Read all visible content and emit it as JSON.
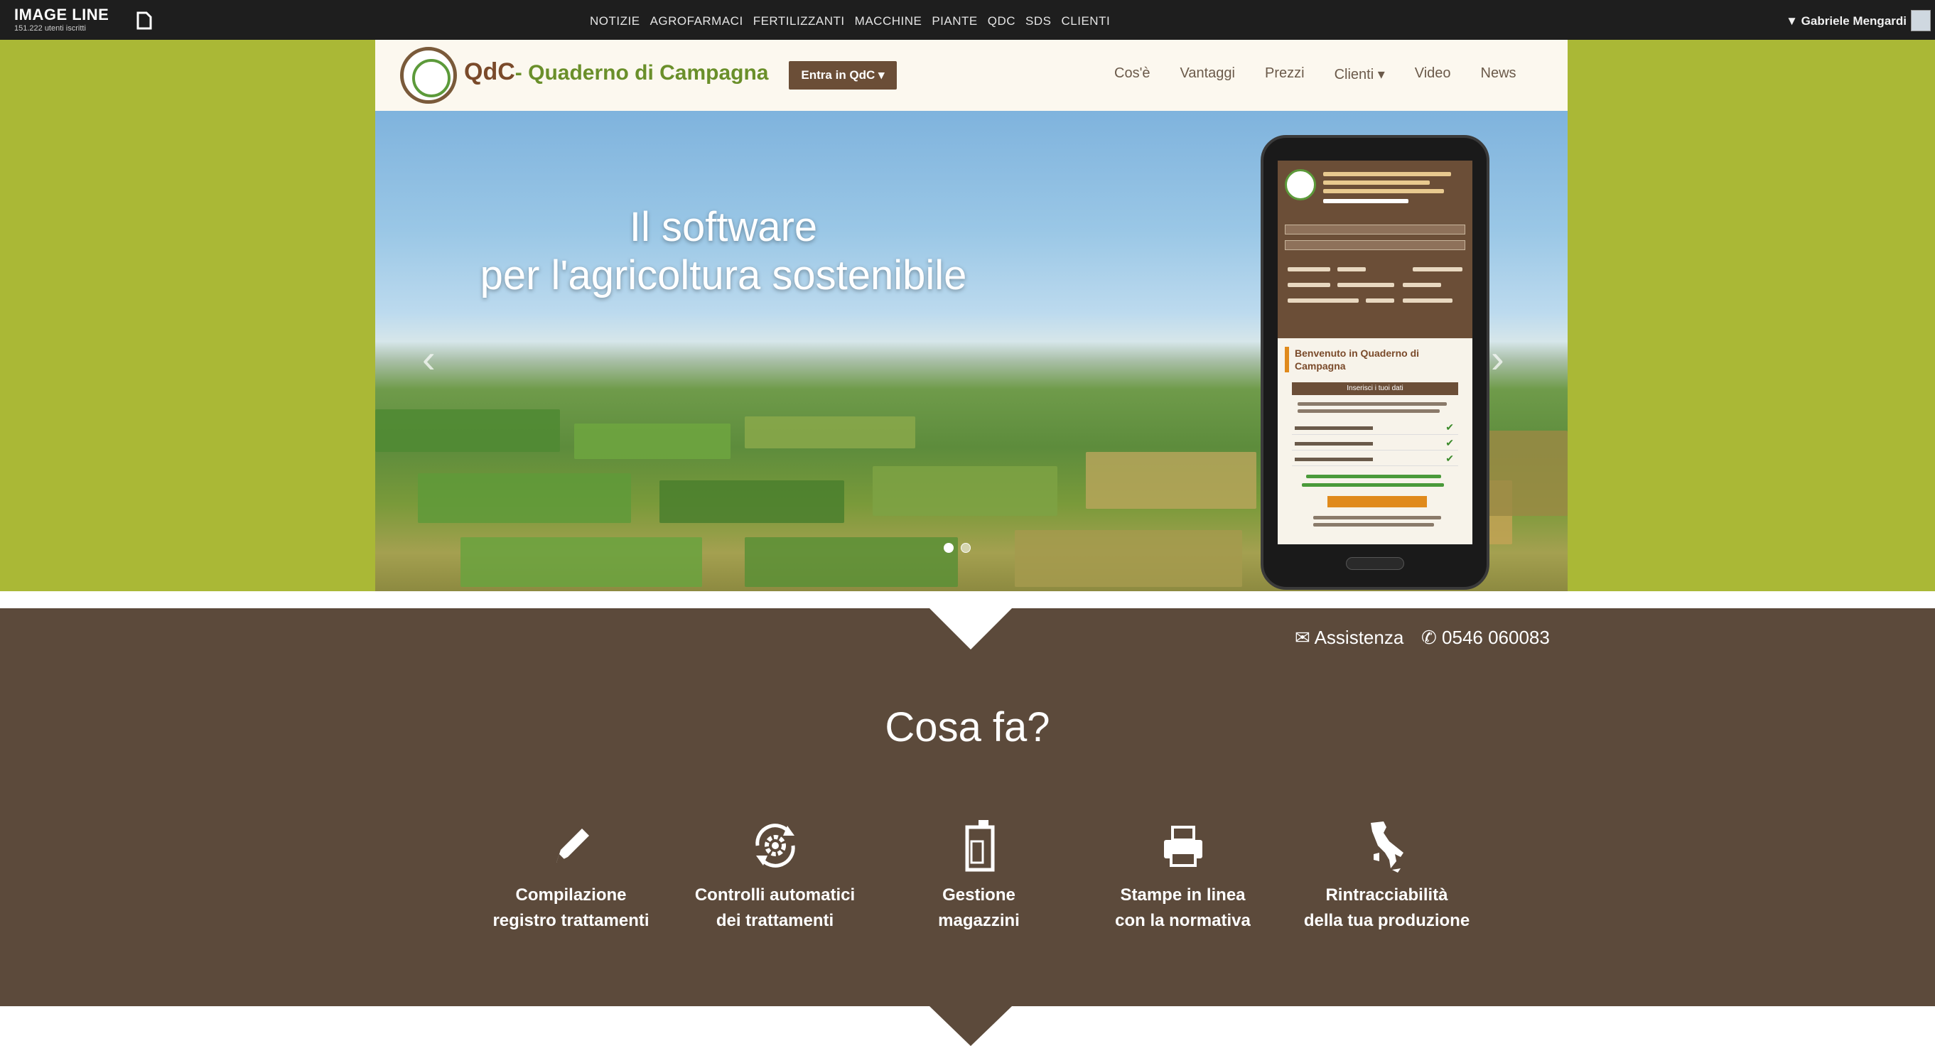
{
  "topbar": {
    "brand_name": "IMAGE LINE",
    "brand_sub": "151.222 utenti iscritti",
    "nav": [
      "NOTIZIE",
      "AGROFARMACI",
      "FERTILIZZANTI",
      "MACCHINE",
      "PIANTE",
      "QDC",
      "SDS",
      "CLIENTI"
    ],
    "user": "▼ Gabriele Mengardi"
  },
  "header": {
    "logo_q": "QdC",
    "logo_text": "- Quaderno di Campagna",
    "entra_label": "Entra in QdC ▾",
    "nav": [
      "Cos'è",
      "Vantaggi",
      "Prezzi",
      "Clienti ▾",
      "Video",
      "News"
    ]
  },
  "hero": {
    "title_line1": "Il software",
    "title_line2": "per l'agricoltura sostenibile",
    "prev": "‹",
    "next": "›",
    "phone_welcome": "Benvenuto in Quaderno di Campagna",
    "phone_bar": "Inserisci i tuoi dati"
  },
  "contact": {
    "assistenza": "Assistenza",
    "phone": "0546 060083"
  },
  "section": {
    "title": "Cosa fa?",
    "features": [
      {
        "line1": "Compilazione",
        "line2": "registro trattamenti",
        "icon": "pencil-icon"
      },
      {
        "line1": "Controlli automatici",
        "line2": "dei trattamenti",
        "icon": "gear-cycle-icon"
      },
      {
        "line1": "Gestione",
        "line2": "magazzini",
        "icon": "canister-icon"
      },
      {
        "line1": "Stampe in linea",
        "line2": "con la normativa",
        "icon": "printer-icon"
      },
      {
        "line1": "Rintracciabilità",
        "line2": "della tua produzione",
        "icon": "italy-map-icon"
      }
    ]
  },
  "colors": {
    "green": "#aab836",
    "brown": "#5c4a3b",
    "button_brown": "#6b4e37",
    "topbar": "#1e1e1e"
  }
}
